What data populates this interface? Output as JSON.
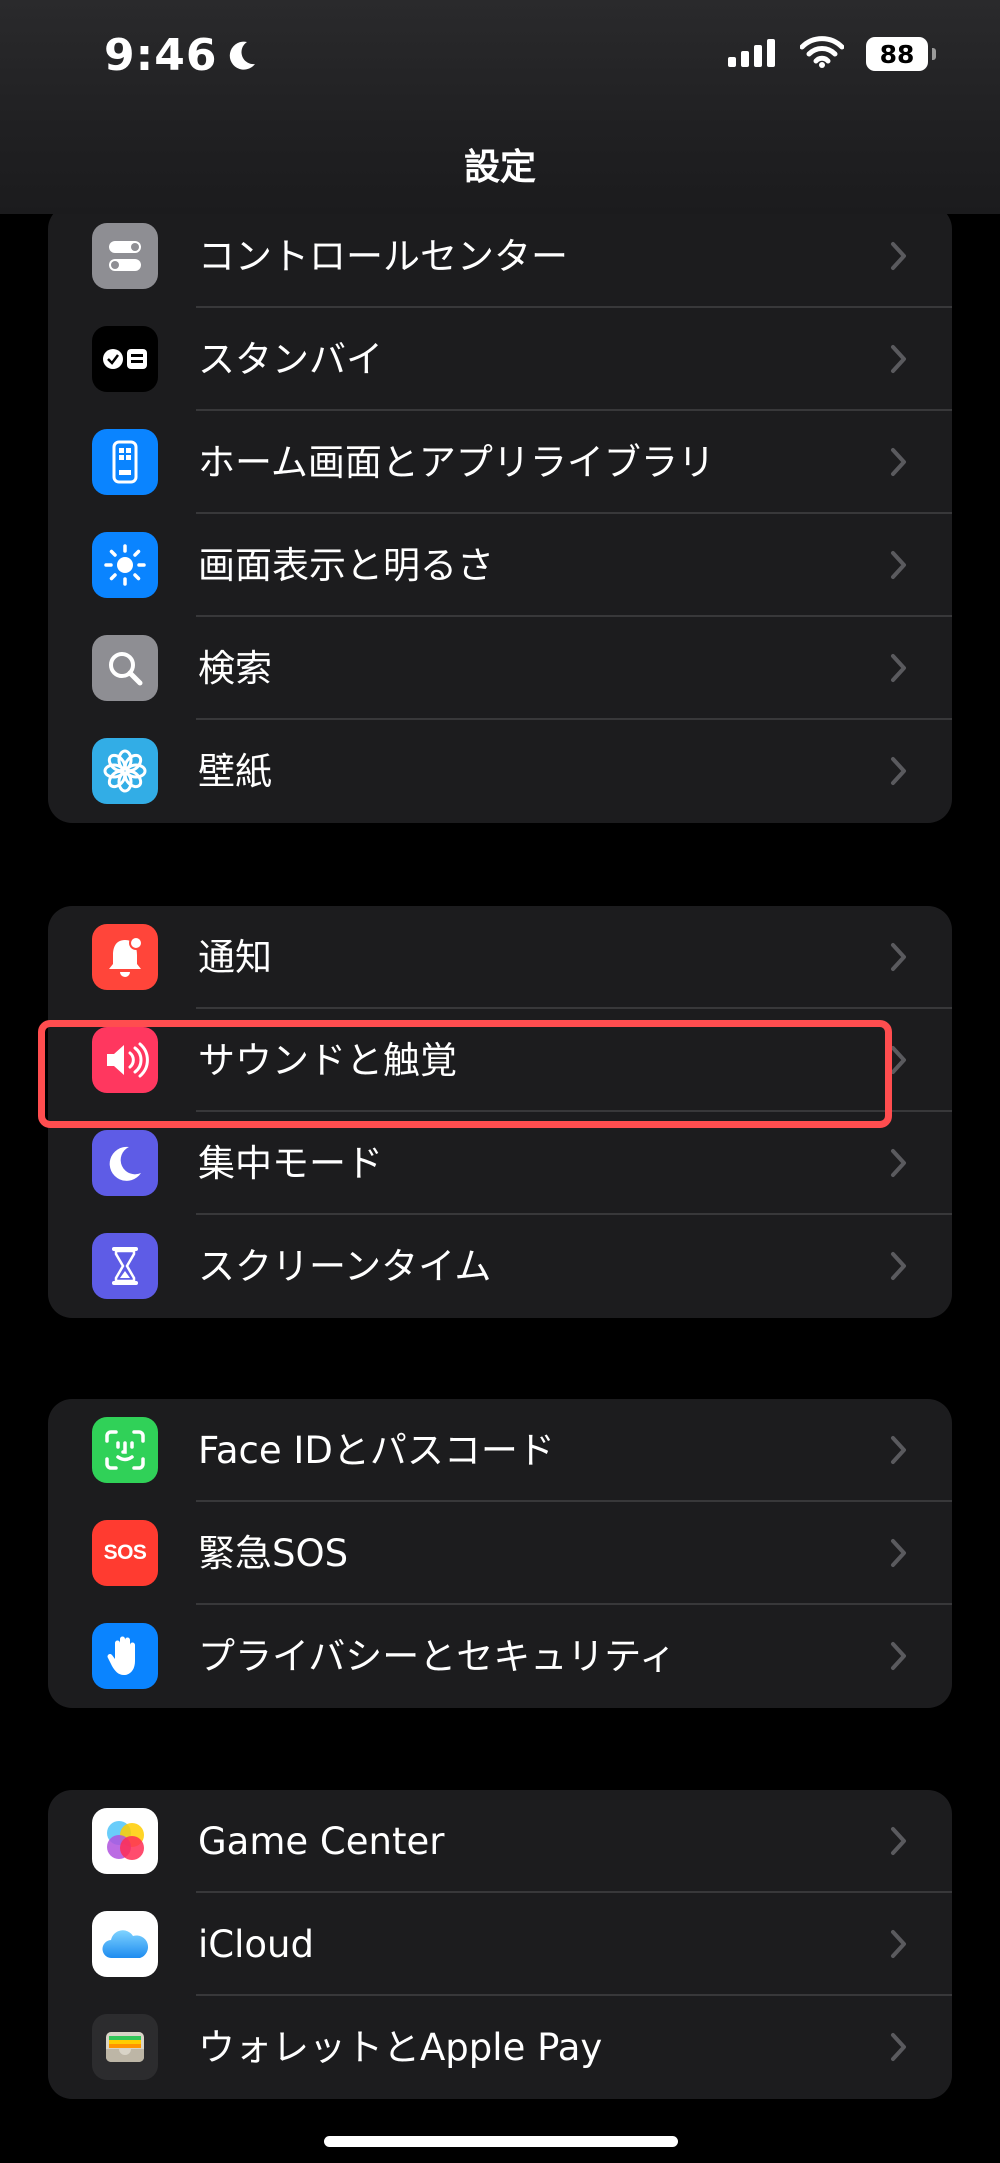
{
  "status": {
    "time": "9:46",
    "battery": "88",
    "icons": [
      "moon-icon",
      "cellular-icon",
      "wifi-icon",
      "battery-icon"
    ]
  },
  "nav": {
    "title": "設定"
  },
  "groups": [
    {
      "items": [
        {
          "label": "コントロールセンター",
          "icon": "control-center-icon",
          "color": "#8e8e93"
        },
        {
          "label": "スタンバイ",
          "icon": "standby-icon",
          "color": "#000000"
        },
        {
          "label": "ホーム画面とアプリライブラリ",
          "icon": "home-screen-icon",
          "color": "#0a84ff"
        },
        {
          "label": "画面表示と明るさ",
          "icon": "brightness-icon",
          "color": "#0a84ff"
        },
        {
          "label": "検索",
          "icon": "search-icon",
          "color": "#8e8e93"
        },
        {
          "label": "壁紙",
          "icon": "wallpaper-icon",
          "color": "#32ade6"
        }
      ]
    },
    {
      "items": [
        {
          "label": "通知",
          "icon": "notification-icon",
          "color": "#ff453a"
        },
        {
          "label": "サウンドと触覚",
          "icon": "sound-icon",
          "color": "#ff375f"
        },
        {
          "label": "集中モード",
          "icon": "focus-moon-icon",
          "color": "#5e5ce6"
        },
        {
          "label": "スクリーンタイム",
          "icon": "hourglass-icon",
          "color": "#5e5ce6"
        }
      ]
    },
    {
      "items": [
        {
          "label": "Face IDとパスコード",
          "icon": "face-id-icon",
          "color": "#30d158"
        },
        {
          "label": "緊急SOS",
          "icon": "sos-icon",
          "color": "#ff3b30",
          "icon_text": "SOS"
        },
        {
          "label": "プライバシーとセキュリティ",
          "icon": "privacy-hand-icon",
          "color": "#0a84ff"
        }
      ]
    },
    {
      "items": [
        {
          "label": "Game Center",
          "icon": "game-center-icon",
          "color": "#ffffff"
        },
        {
          "label": "iCloud",
          "icon": "icloud-icon",
          "color": "#ffffff"
        },
        {
          "label": "ウォレットとApple Pay",
          "icon": "wallet-icon",
          "color": "#1c1c1e"
        }
      ]
    }
  ],
  "highlight": {
    "target": "サウンドと触覚",
    "color": "#ff4d4f"
  }
}
